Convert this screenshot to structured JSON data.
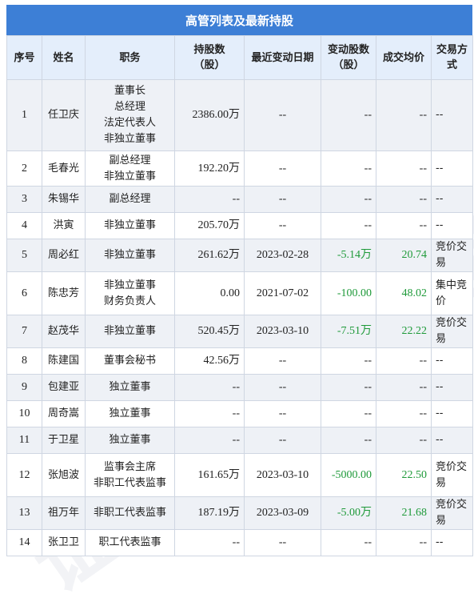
{
  "title": "高管列表及最新持股",
  "headers": {
    "index": "序号",
    "name": "姓名",
    "position": "职务",
    "holdings": "持股数\n（股）",
    "date": "最近变动日期",
    "change": "变动股数\n（股）",
    "price": "成交均价",
    "method": "交易方式"
  },
  "rows": [
    {
      "index": "1",
      "name": "任卫庆",
      "position": [
        "董事长",
        "总经理",
        "法定代表人",
        "非独立董事"
      ],
      "holdings": "2386.00万",
      "date": "--",
      "change": "--",
      "price": "--",
      "method": "--"
    },
    {
      "index": "2",
      "name": "毛春光",
      "position": [
        "副总经理",
        "非独立董事"
      ],
      "holdings": "192.20万",
      "date": "--",
      "change": "--",
      "price": "--",
      "method": "--"
    },
    {
      "index": "3",
      "name": "朱锡华",
      "position": [
        "副总经理"
      ],
      "holdings": "--",
      "date": "--",
      "change": "--",
      "price": "--",
      "method": "--"
    },
    {
      "index": "4",
      "name": "洪寅",
      "position": [
        "非独立董事"
      ],
      "holdings": "205.70万",
      "date": "--",
      "change": "--",
      "price": "--",
      "method": "--"
    },
    {
      "index": "5",
      "name": "周必红",
      "position": [
        "非独立董事"
      ],
      "holdings": "261.62万",
      "date": "2023-02-28",
      "change": "-5.14万",
      "price": "20.74",
      "method": "竞价交易"
    },
    {
      "index": "6",
      "name": "陈忠芳",
      "position": [
        "非独立董事",
        "财务负责人"
      ],
      "holdings": "0.00",
      "date": "2021-07-02",
      "change": "-100.00",
      "price": "48.02",
      "method": "集中竞价"
    },
    {
      "index": "7",
      "name": "赵茂华",
      "position": [
        "非独立董事"
      ],
      "holdings": "520.45万",
      "date": "2023-03-10",
      "change": "-7.51万",
      "price": "22.22",
      "method": "竞价交易"
    },
    {
      "index": "8",
      "name": "陈建国",
      "position": [
        "董事会秘书"
      ],
      "holdings": "42.56万",
      "date": "--",
      "change": "--",
      "price": "--",
      "method": "--"
    },
    {
      "index": "9",
      "name": "包建亚",
      "position": [
        "独立董事"
      ],
      "holdings": "--",
      "date": "--",
      "change": "--",
      "price": "--",
      "method": "--"
    },
    {
      "index": "10",
      "name": "周奇嵩",
      "position": [
        "独立董事"
      ],
      "holdings": "--",
      "date": "--",
      "change": "--",
      "price": "--",
      "method": "--"
    },
    {
      "index": "11",
      "name": "于卫星",
      "position": [
        "独立董事"
      ],
      "holdings": "--",
      "date": "--",
      "change": "--",
      "price": "--",
      "method": "--"
    },
    {
      "index": "12",
      "name": "张旭波",
      "position": [
        "监事会主席",
        "非职工代表监事"
      ],
      "holdings": "161.65万",
      "date": "2023-03-10",
      "change": "-5000.00",
      "price": "22.50",
      "method": "竞价交易"
    },
    {
      "index": "13",
      "name": "祖万年",
      "position": [
        "非职工代表监事"
      ],
      "holdings": "187.19万",
      "date": "2023-03-09",
      "change": "-5.00万",
      "price": "21.68",
      "method": "竞价交易"
    },
    {
      "index": "14",
      "name": "张卫卫",
      "position": [
        "职工代表监事"
      ],
      "holdings": "--",
      "date": "--",
      "change": "--",
      "price": "--",
      "method": "--"
    }
  ],
  "colors": {
    "title_bg": "#3d7fd6",
    "header_bg": "#e4eefb",
    "odd_row_bg": "#eef1f6",
    "change_color": "#1f9a3a"
  },
  "watermark": "证券之星"
}
